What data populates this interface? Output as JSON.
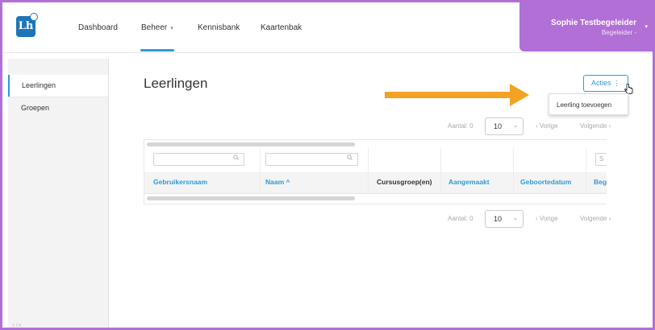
{
  "app": {
    "logo_text": "Lh"
  },
  "nav": {
    "items": [
      {
        "label": "Dashboard"
      },
      {
        "label": "Beheer",
        "caret": "▾"
      },
      {
        "label": "Kennisbank"
      },
      {
        "label": "Kaartenbak"
      }
    ]
  },
  "user": {
    "name": "Sophie Testbegeleider",
    "role": "Begeleider -",
    "caret": "▾"
  },
  "sidebar": {
    "items": [
      {
        "label": "Leerlingen",
        "active": true
      },
      {
        "label": "Groepen",
        "active": false
      }
    ],
    "version": "1.7.5"
  },
  "main": {
    "title": "Leerlingen",
    "acties_label": "Acties",
    "acties_kebab": "⋮",
    "dropdown_items": [
      {
        "label": "Leerling toevoegen"
      }
    ]
  },
  "pagination": {
    "count_label": "Aantal: 0",
    "page_size": "10",
    "chevron": "⌄",
    "prev_label": "‹  Vorige",
    "next_label": "Volgende  ›"
  },
  "table": {
    "columns": [
      {
        "label": "Gebruikersnaam",
        "sortable": true
      },
      {
        "label": "Naam ^",
        "sortable": true
      },
      {
        "label": "Cursusgroep(en)",
        "sortable": false
      },
      {
        "label": "Aangemaakt",
        "sortable": true
      },
      {
        "label": "Geboortedatum",
        "sortable": true
      },
      {
        "label": "Beg",
        "sortable": true
      }
    ],
    "filter_partial_text": "S"
  },
  "colors": {
    "accent": "#2b9bd8",
    "user_bg": "#b26fd6",
    "arrow": "#f2a324",
    "logo": "#1f74b8"
  }
}
